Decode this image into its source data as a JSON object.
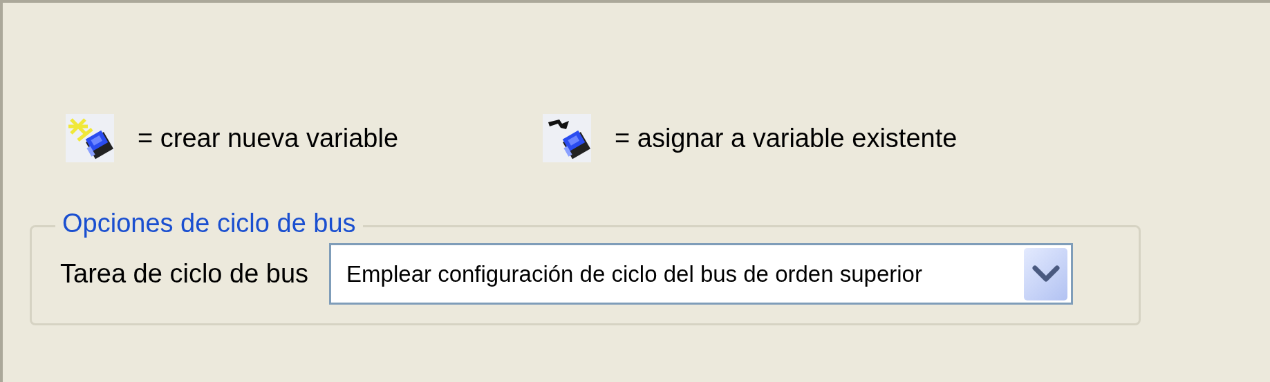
{
  "legend": [
    {
      "kind": "new",
      "text": "= crear nueva variable"
    },
    {
      "kind": "existing",
      "text": "= asignar a variable existente"
    }
  ],
  "bus_cycle_options": {
    "title": "Opciones de ciclo de bus",
    "label": "Tarea de ciclo de bus",
    "value": "Emplear configuración de ciclo del bus de orden superior"
  }
}
